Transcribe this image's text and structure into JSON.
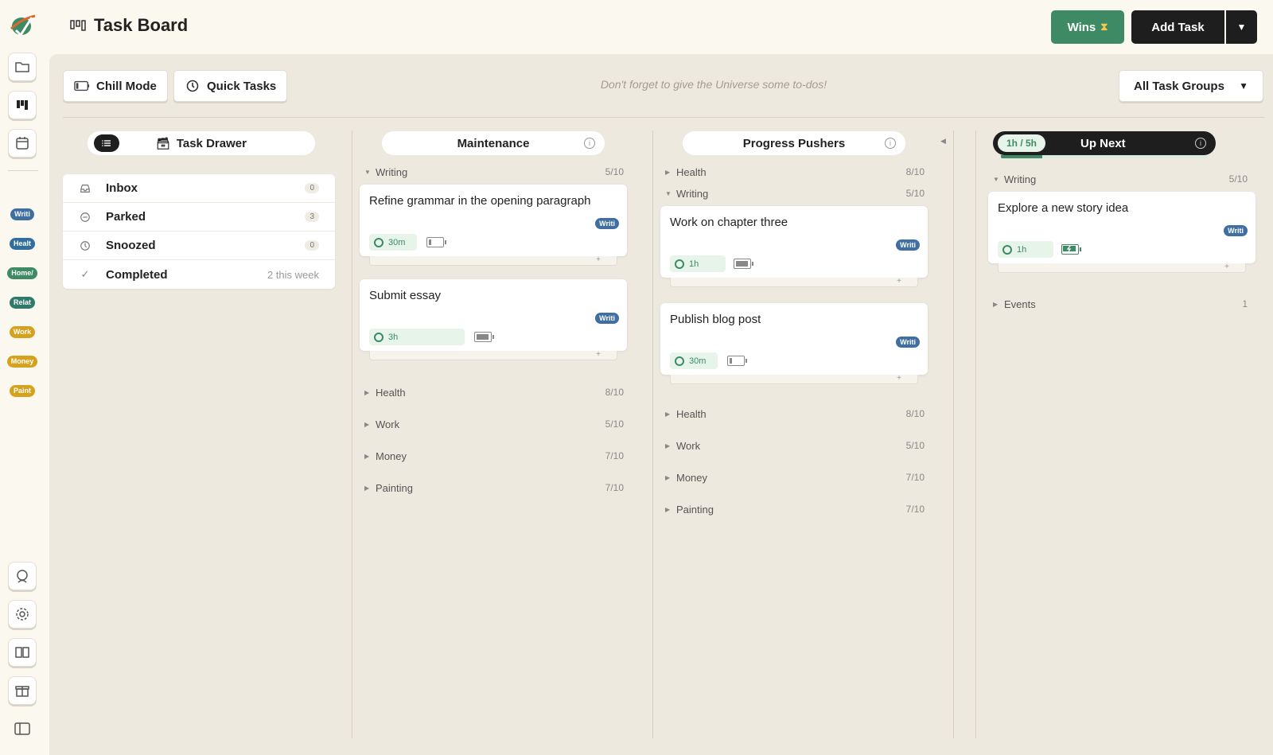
{
  "header": {
    "title": "Task Board",
    "wins_label": "Wins",
    "add_task_label": "Add Task"
  },
  "sidebar": {
    "tags": [
      {
        "label": "Writi",
        "color": "#3f6ea3"
      },
      {
        "label": "Healt",
        "color": "#2f6e9e"
      },
      {
        "label": "Home/",
        "color": "#3d8a64"
      },
      {
        "label": "Relat",
        "color": "#2f7a6a"
      },
      {
        "label": "Work",
        "color": "#d6a21e"
      },
      {
        "label": "Money",
        "color": "#d6a21e"
      },
      {
        "label": "Paint",
        "color": "#d6a21e"
      }
    ]
  },
  "toolbar": {
    "chill_mode_label": "Chill Mode",
    "quick_tasks_label": "Quick Tasks",
    "hint": "Don't forget to give the Universe some to-dos!",
    "task_groups_label": "All Task Groups"
  },
  "drawer": {
    "title": "Task Drawer",
    "items": [
      {
        "label": "Inbox",
        "count": "0"
      },
      {
        "label": "Parked",
        "count": "3"
      },
      {
        "label": "Snoozed",
        "count": "0"
      },
      {
        "label": "Completed",
        "note": "2 this week"
      }
    ]
  },
  "maintenance": {
    "title": "Maintenance",
    "writing_group": {
      "name": "Writing",
      "count": "5/10"
    },
    "cards": [
      {
        "title": "Refine grammar in the opening paragraph",
        "tag": "Writi",
        "duration": "30m",
        "energy": 0.2
      },
      {
        "title": "Submit essay",
        "tag": "Writi",
        "duration": "3h",
        "energy": 1.0
      }
    ],
    "groups": [
      {
        "name": "Health",
        "count": "8/10"
      },
      {
        "name": "Work",
        "count": "5/10"
      },
      {
        "name": "Money",
        "count": "7/10"
      },
      {
        "name": "Painting",
        "count": "7/10"
      }
    ]
  },
  "progress": {
    "title": "Progress Pushers",
    "health_group": {
      "name": "Health",
      "count": "8/10"
    },
    "writing_group": {
      "name": "Writing",
      "count": "5/10"
    },
    "cards": [
      {
        "title": "Work on chapter three",
        "tag": "Writi",
        "duration": "1h",
        "energy": 1.0
      },
      {
        "title": "Publish blog post",
        "tag": "Writi",
        "duration": "30m",
        "energy": 0.2
      }
    ],
    "groups": [
      {
        "name": "Health",
        "count": "8/10"
      },
      {
        "name": "Work",
        "count": "5/10"
      },
      {
        "name": "Money",
        "count": "7/10"
      },
      {
        "name": "Painting",
        "count": "7/10"
      }
    ]
  },
  "upnext": {
    "title": "Up Next",
    "capacity": "1h / 5h",
    "progress": 0.2,
    "writing_group": {
      "name": "Writing",
      "count": "5/10"
    },
    "card": {
      "title": "Explore a new story idea",
      "tag": "Writi",
      "duration": "1h"
    },
    "events_group": {
      "name": "Events",
      "count": "1"
    }
  },
  "colors": {
    "accent_green": "#3d8a64",
    "dark": "#1e1e1e",
    "tag_blue": "#3f6ea3",
    "tag_yellow": "#d6a21e"
  }
}
